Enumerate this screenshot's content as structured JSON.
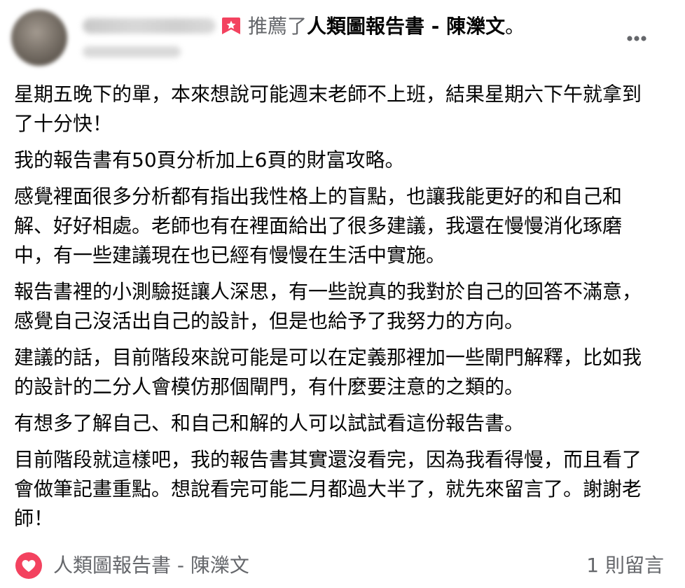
{
  "header": {
    "recommend_verb": "推薦了",
    "page_name": "人類圖報告書 - 陳濼文",
    "period": "。",
    "recommend_icon": "recommend-flag-icon",
    "more_icon": "more-horizontal-icon"
  },
  "post": {
    "paragraphs": [
      "星期五晚下的單，本來想說可能週末老師不上班，結果星期六下午就拿到了十分快！",
      "我的報告書有50頁分析加上6頁的財富攻略。",
      "感覺裡面很多分析都有指出我性格上的盲點，也讓我能更好的和自己和解、好好相處。老師也有在裡面給出了很多建議，我還在慢慢消化琢磨中，有一些建議現在也已經有慢慢在生活中實施。",
      "報告書裡的小測驗挺讓人深思，有一些說真的我對於自己的回答不滿意，感覺自己沒活出自己的設計，但是也給予了我努力的方向。",
      "建議的話，目前階段來說可能是可以在定義那裡加一些閘門解釋，比如我的設計的二分人會模仿那個閘門，有什麼要注意的之類的。",
      "有想多了解自己、和自己和解的人可以試試看這份報告書。",
      "目前階段就這樣吧，我的報告書其實還沒看完，因為我看得慢，而且看了會做筆記畫重點。想說看完可能二月都過大半了，就先來留言了。謝謝老師！"
    ]
  },
  "footer": {
    "page_name": "人類圖報告書 - 陳濼文",
    "comment_count": "1 則留言",
    "heart_icon": "heart-icon"
  },
  "colors": {
    "recommend_red": "#f3425f",
    "secondary_text": "#65676b",
    "primary_text": "#050505"
  }
}
